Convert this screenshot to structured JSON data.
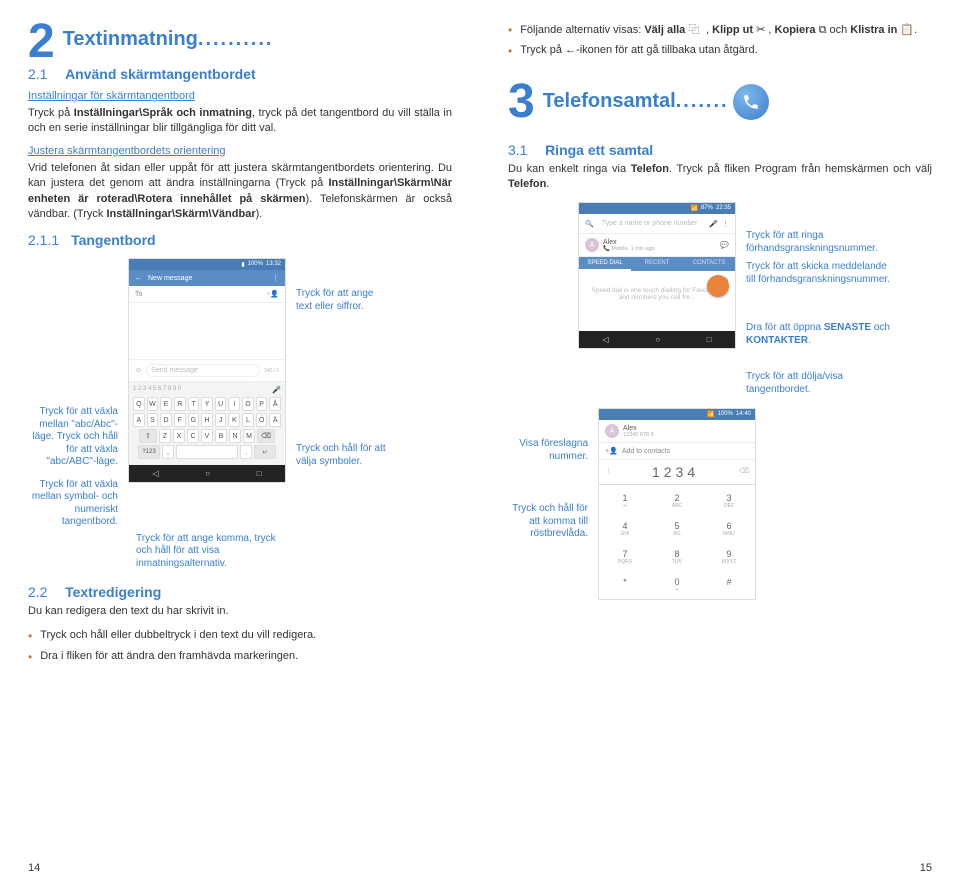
{
  "left": {
    "num": "2",
    "title": "Textinmatning",
    "dots": "..........",
    "s21num": "2.1",
    "s21": "Använd skärmtangentbordet",
    "link1": "Inställningar för skärmtangentbord",
    "p1a": "Tryck på ",
    "p1b": "Inställningar\\Språk och inmatning",
    "p1c": ", tryck på det tangentbord du vill ställa in och en serie inställningar blir tillgängliga för ditt val.",
    "link2": "Justera skärmtangentbordets orientering",
    "p2a": "Vrid telefonen åt sidan eller uppåt för att justera skärmtangentbordets orientering. Du kan justera det genom att ändra inställningarna (Tryck på ",
    "p2b": "Inställningar\\Skärm\\När enheten är roterad\\Rotera innehållet på skärmen",
    "p2c": "). Telefonskärmen är också vändbar. (Tryck ",
    "p2d": "Inställningar\\Skärm\\Vändbar",
    "p2e": ").",
    "s211num": "2.1.1",
    "s211": "Tangentbord",
    "call_text": "Tryck för att ange text eller siffror.",
    "call_abc": "Tryck för att växla mellan \"abc/Abc\"-läge. Tryck och håll för att växla \"abc/ABC\"-läge.",
    "call_sym": "Tryck för att växla mellan symbol- och numeriskt tangentbord.",
    "call_komma": "Tryck för att ange komma, tryck och håll för att visa inmatningsalternativ.",
    "call_hold": "Tryck och håll för att välja symboler.",
    "s22num": "2.2",
    "s22": "Textredigering",
    "p3": "Du kan redigera den text du har skrivit in.",
    "b1": "Tryck och håll eller dubbeltryck i den text du vill redigera.",
    "b2": "Dra i fliken för att ändra den framhävda markeringen.",
    "phone1": {
      "time": "13:32",
      "batt": "100%",
      "title": "New message",
      "to": "To",
      "send": "Send message",
      "counter": "140 / 1",
      "rows": [
        "Q",
        "W",
        "E",
        "R",
        "T",
        "Y",
        "U",
        "I",
        "O",
        "P",
        "Å"
      ],
      "rows2": [
        "A",
        "S",
        "D",
        "F",
        "G",
        "H",
        "J",
        "K",
        "L",
        "Ö",
        "Ä"
      ],
      "rows3": [
        "Z",
        "X",
        "C",
        "V",
        "B",
        "N",
        "M"
      ],
      "fn": "?123"
    }
  },
  "right": {
    "b1a": "Följande alternativ visas: ",
    "b1b": "Välj alla",
    "b1c": ", ",
    "b1d": "Klipp ut",
    "b1e": ", ",
    "b1f": "Kopiera",
    "b1g": " och ",
    "b1h": "Klistra in",
    "b1i": ".",
    "b2a": "Tryck på ",
    "b2b": "-ikonen för att gå tillbaka utan åtgärd.",
    "num": "3",
    "title": "Telefonsamtal",
    "dots": ".......",
    "s31num": "3.1",
    "s31": "Ringa ett samtal",
    "p1a": "Du kan enkelt ringa via ",
    "p1b": "Telefon",
    "p1c": ". Tryck på fliken Program från hemskärmen och välj ",
    "p1d": "Telefon",
    "p1e": ".",
    "call_ring": "Tryck för att ringa förhandsgranskningsnummer.",
    "call_msg": "Tryck för att skicka meddelande till förhandsgranskningsnummer.",
    "call_drag": "Dra för att öppna SENASTE och KONTAKTER.",
    "call_hide": "Tryck för att dölja/visa tangentbordet.",
    "call_visa": "Visa föreslagna nummer.",
    "call_voice": "Tryck och håll för att komma till röstbrevlåda.",
    "phone2": {
      "batt": "87%",
      "time": "22:35",
      "search": "Type a name or phone number",
      "alex": "Alex",
      "alexsub": "Mobile, 1 min ago",
      "tabs": [
        "SPEED DIAL",
        "RECENT",
        "CONTACTS"
      ],
      "hint": "Speed dial is one touch dialling for Favourites and numbers you call fre..."
    },
    "phone3": {
      "batt": "100%",
      "time": "14:40",
      "alex": "Alex",
      "alexnum": "12345 678 9",
      "add": "Add to contacts",
      "typed": "1234",
      "keys": [
        [
          "1",
          ""
        ],
        [
          "2",
          "ABC"
        ],
        [
          "3",
          "DEF"
        ],
        [
          "4",
          "GHI"
        ],
        [
          "5",
          "JKL"
        ],
        [
          "6",
          "MNO"
        ],
        [
          "7",
          "PQRS"
        ],
        [
          "8",
          "TUV"
        ],
        [
          "9",
          "WXYZ"
        ],
        [
          "*",
          ""
        ],
        [
          "0",
          "+"
        ],
        [
          "#",
          ""
        ]
      ]
    }
  },
  "pagenum_left": "14",
  "pagenum_right": "15"
}
